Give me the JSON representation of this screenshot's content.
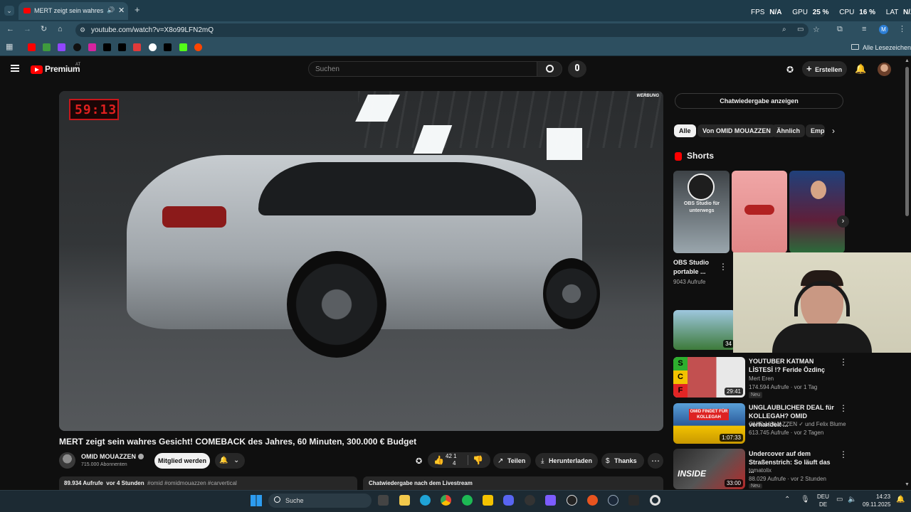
{
  "browser": {
    "tab_title": "MERT zeigt sein wahres Ge",
    "url": "youtube.com/watch?v=X8o99LFN2mQ",
    "bookmarks_all": "Alle Lesezeichen",
    "profile_initial": "M"
  },
  "overlay_stats": {
    "fps_label": "FPS",
    "fps_value": "N/A",
    "gpu_label": "GPU",
    "gpu_value": "25 %",
    "cpu_label": "CPU",
    "cpu_value": "16 %",
    "lat_label": "LAT",
    "lat_value": "N/A"
  },
  "youtube": {
    "logo_text": "Premium",
    "logo_region": "AT",
    "search_placeholder": "Suchen",
    "create_label": "Erstellen"
  },
  "video": {
    "timer": "59:13",
    "ad_badge": "WERBUNG",
    "title": "MERT zeigt sein wahres Gesicht! COMEBACK des Jahres, 60 Minuten, 300.000 € Budget",
    "channel": "OMID MOUAZZEN",
    "subscribers": "715.000 Abonnenten",
    "join_label": "Mitglied werden",
    "likes": "42 1",
    "likes_sub": "4",
    "share_label": "Teilen",
    "download_label": "Herunterladen",
    "thanks_label": "Thanks",
    "views_date": "89.934 Aufrufe  vor 4 Stunden",
    "hashtags": "#omid #omidmouazzen #carvertical",
    "chat_replay_bottom": "Chatwiedergabe nach dem Livestream"
  },
  "sidebar": {
    "chat_replay_button": "Chatwiedergabe anzeigen",
    "chips": [
      "Alle",
      "Von OMID MOUAZZEN",
      "Ähnlich",
      "Emp"
    ],
    "shorts_title": "Shorts",
    "shorts": [
      {
        "thumb_text": "OBS Studio für unterwegs",
        "title": "OBS Studio portable ...",
        "views": "9043 Aufrufe"
      }
    ],
    "recommendations": [
      {
        "title": "YOUTUBER KATMAN LİSTESİ !? Feride Özdinç",
        "channel": "Mert Eren",
        "meta": "174.594 Aufrufe · vor 1 Tag",
        "badge": "Neu",
        "duration": "29:41"
      },
      {
        "title": "UNGLAUBLICHER DEAL für KOLLEGAH? OMID verhandelt ...",
        "channel": "OMID MOUAZZEN",
        "channel_extra": "und Felix Blume",
        "meta": "613.745 Aufrufe · vor 2 Tagen",
        "duration": "1:07:33",
        "thumb_text": "OMID FINDET FÜR KOLLEGAH"
      },
      {
        "title": "Undercover auf dem Straßenstrich: So läuft das ...",
        "channel": "tomatolix",
        "meta": "88.029 Aufrufe · vor 2 Stunden",
        "badge": "Neu",
        "duration": "33:00",
        "thumb_text": "INSIDE"
      }
    ],
    "tier_letters": [
      "S",
      "C",
      "F"
    ],
    "partial_duration": "34"
  },
  "taskbar": {
    "search_label": "Suche",
    "lang_top": "DEU",
    "lang_bottom": "DE",
    "time": "14:23",
    "date": "09.11.2025"
  },
  "colors": {
    "accent_red": "#ff0000",
    "chrome_bg": "#2d4f60",
    "page_bg": "#0f0f0f"
  }
}
